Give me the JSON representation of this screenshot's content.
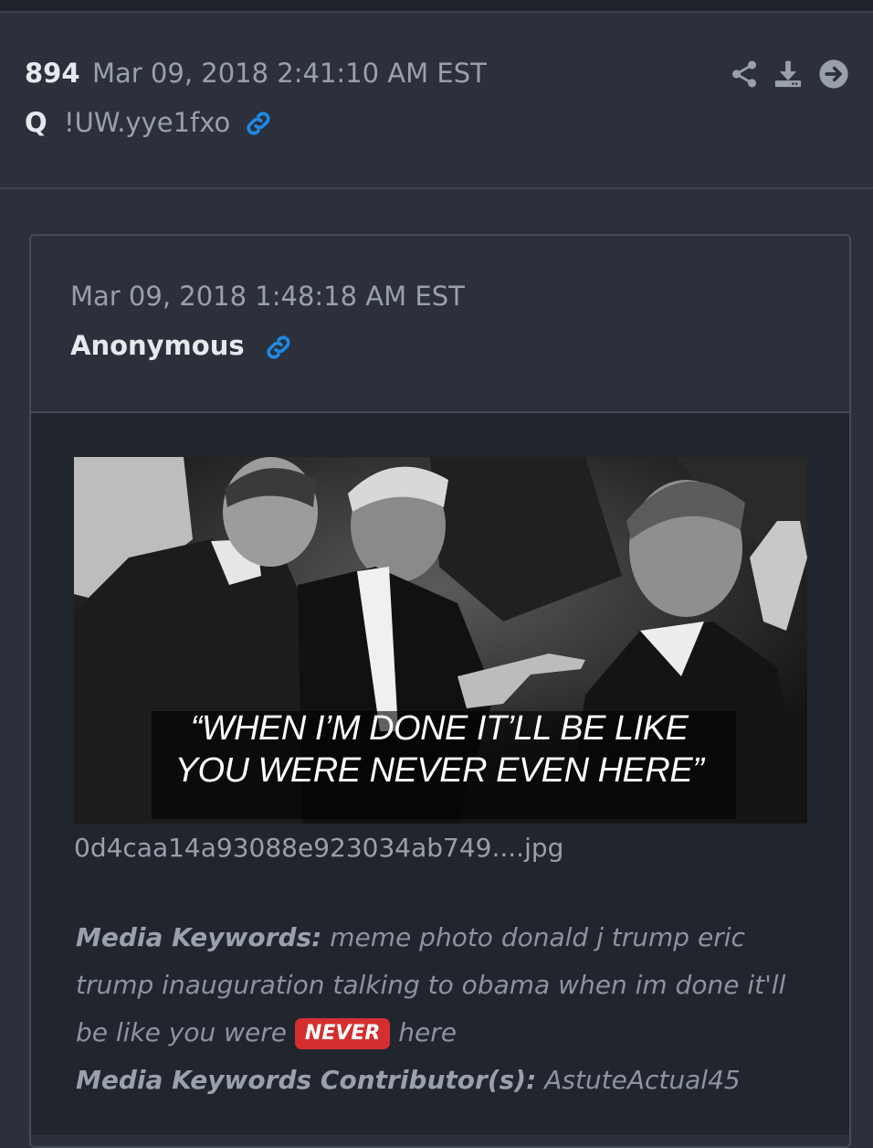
{
  "post": {
    "number": "894",
    "date": "Mar 09, 2018 2:41:10 AM EST",
    "author": "Q",
    "tripcode": "!UW.yye1fxo",
    "icons": [
      "share-icon",
      "download-icon",
      "arrow-right-circle-icon",
      "link-icon"
    ]
  },
  "quoted_post": {
    "date": "Mar 09, 2018 1:48:18 AM EST",
    "author": "Anonymous",
    "image_caption_line1": "“WHEN I’M DONE IT’LL BE LIKE",
    "image_caption_line2": "YOU WERE NEVER EVEN HERE”",
    "file_name": "0d4caa14a93088e923034ab749....jpg",
    "media_keywords_label": "Media Keywords:",
    "media_keywords_before": " meme photo donald j trump eric trump inauguration talking to obama when im done it'll be like you were ",
    "media_keywords_highlight": "NEVER",
    "media_keywords_after": " here",
    "contributors_label": "Media Keywords Contributor(s):",
    "contributors_value": " AstuteActual45"
  },
  "colors": {
    "background": "#2b303b",
    "inner_background": "#21252e",
    "link_blue": "#1e88e5",
    "badge_red": "#d32f2f"
  }
}
